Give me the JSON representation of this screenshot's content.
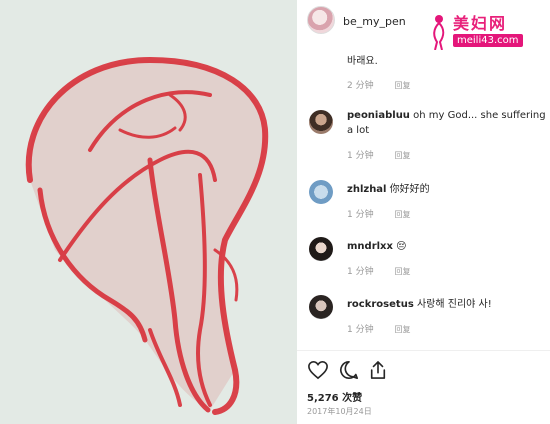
{
  "post": {
    "username": "be_my_pen",
    "image_alt": "red-chalk-figure-drawing"
  },
  "watermark": {
    "chinese": "美妇网",
    "url": "meili43.com"
  },
  "comments": [
    {
      "username": "",
      "text": "바래요.",
      "time": "2 分钟",
      "reply": "回复"
    },
    {
      "username": "peoniabluu",
      "text": "oh my God... she suffering a lot",
      "time": "1 分钟",
      "reply": "回复"
    },
    {
      "username": "zhlzhal",
      "text": "你好好的",
      "time": "1 分钟",
      "reply": "回复"
    },
    {
      "username": "mndrlxx",
      "text": "😔",
      "time": "1 分钟",
      "reply": "回复"
    },
    {
      "username": "rockrosetus",
      "text": "사랑해 진리야 사!",
      "time": "1 分钟",
      "reply": "回复"
    }
  ],
  "likes": "5,276 次赞",
  "date": "2017年10月24日",
  "icons": [
    "heart-icon",
    "comment-icon",
    "share-icon"
  ],
  "colors": {
    "chalk": "#d8303a",
    "paper": "#dfe7e1",
    "watermark": "#e4167a"
  }
}
